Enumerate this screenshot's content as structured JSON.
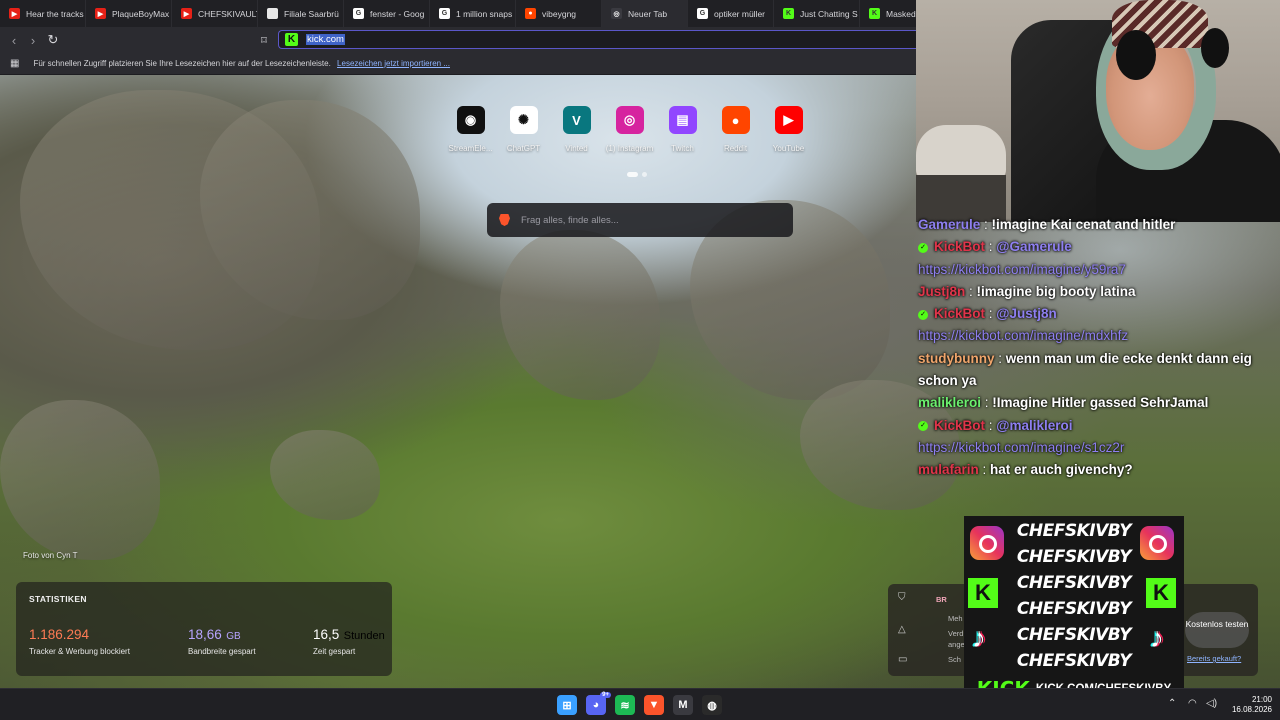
{
  "tabs": [
    {
      "label": "Hear the tracks",
      "fav_color": "#e62117",
      "fav_glyph": "▶"
    },
    {
      "label": "PlaqueBoyMax",
      "fav_color": "#e62117",
      "fav_glyph": "▶"
    },
    {
      "label": "CHEFSKIVAULT",
      "fav_color": "#e62117",
      "fav_glyph": "▶"
    },
    {
      "label": "Filiale Saarbrü",
      "fav_color": "#e8e8e8",
      "fav_glyph": ""
    },
    {
      "label": "fenster - Goog",
      "fav_color": "#ffffff",
      "fav_glyph": "G"
    },
    {
      "label": "1 million snaps",
      "fav_color": "#ffffff",
      "fav_glyph": "G"
    },
    {
      "label": "vibeygng",
      "fav_color": "#ff4500",
      "fav_glyph": "●"
    },
    {
      "label": "Neuer Tab",
      "fav_color": "#3a3a40",
      "fav_glyph": "◎"
    },
    {
      "label": "optiker müller",
      "fav_color": "#ffffff",
      "fav_glyph": "G"
    },
    {
      "label": "Just Chatting S",
      "fav_color": "#53fc18",
      "fav_glyph": "K"
    },
    {
      "label": "Masked",
      "fav_color": "#53fc18",
      "fav_glyph": "K"
    }
  ],
  "address": {
    "url": "kick.com"
  },
  "bookmarks": {
    "hint": "Für schnellen Zugriff platzieren Sie Ihre Lesezeichen hier auf der Lesezeichenleiste.",
    "import_link": "Lesezeichen jetzt importieren ..."
  },
  "shortcuts": [
    {
      "label": "StreamEle...",
      "icon": "streamelements-icon",
      "color": "#101010",
      "glyph": "◉"
    },
    {
      "label": "ChatGPT",
      "icon": "chatgpt-icon",
      "color": "#ffffff",
      "glyph": "✺"
    },
    {
      "label": "Vinted",
      "icon": "vinted-icon",
      "color": "#09777f",
      "glyph": "V"
    },
    {
      "label": "(1) Instagram",
      "icon": "instagram-icon",
      "color": "#d6249f",
      "glyph": "◎"
    },
    {
      "label": "Twitch",
      "icon": "twitch-icon",
      "color": "#9146ff",
      "glyph": "▤"
    },
    {
      "label": "Reddit",
      "icon": "reddit-icon",
      "color": "#ff4500",
      "glyph": "●"
    },
    {
      "label": "YouTube",
      "icon": "youtube-icon",
      "color": "#ff0000",
      "glyph": "▶"
    }
  ],
  "search": {
    "placeholder": "Frag alles, finde alles..."
  },
  "photo_credit": "Foto von Cyn T",
  "stats": {
    "title": "STATISTIKEN",
    "items": [
      {
        "value": "1.186.294",
        "unit": "",
        "label": "Tracker & Werbung blockiert",
        "color": "#ff7b54"
      },
      {
        "value": "18,66",
        "unit": "GB",
        "label": "Bandbreite gespart",
        "color": "#b7a4ff"
      },
      {
        "value": "16,5",
        "unit": "Stunden",
        "label": "Zeit gespart",
        "color": "#ffffff"
      }
    ]
  },
  "chat": [
    {
      "badge": false,
      "user": "Gamerule",
      "user_color": "#8e7ff0",
      "text": "!imagine Kai cenat and hitler",
      "link": ""
    },
    {
      "badge": true,
      "user": "KickBot",
      "user_color": "#e0344a",
      "text": "@Gamerule",
      "link": "https://kickbot.com/imagine/y59ra7"
    },
    {
      "badge": false,
      "user": "Justj8n",
      "user_color": "#e0344a",
      "text": "!imagine big booty latina",
      "link": ""
    },
    {
      "badge": true,
      "user": "KickBot",
      "user_color": "#e0344a",
      "text": "@Justj8n",
      "link": "https://kickbot.com/imagine/mdxhfz"
    },
    {
      "badge": false,
      "user": "studybunny",
      "user_color": "#f0a56b",
      "text": "wenn man um die ecke denkt dann eig schon ya",
      "link": ""
    },
    {
      "badge": false,
      "user": "malikleroi",
      "user_color": "#6bf06e",
      "text": "!Imagine Hitler gassed SehrJamal",
      "link": ""
    },
    {
      "badge": true,
      "user": "KickBot",
      "user_color": "#e0344a",
      "text": "@malikleroi",
      "link": "https://kickbot.com/imagine/s1cz2r"
    },
    {
      "badge": false,
      "user": "mulafarin",
      "user_color": "#e0344a",
      "text": "hat er auch givenchy?",
      "link": ""
    }
  ],
  "banner": {
    "rows": [
      "CHEFSKIVBY",
      "CHEFSKIVBY",
      "CHEFSKIVBY",
      "CHEFSKIVBY",
      "CHEFSKIVBY",
      "CHEFSKIVBY"
    ],
    "kick_logo": "KICK",
    "kick_url": "KICK.COM/CHEFSKIVBY"
  },
  "rewards": {
    "title": "BR",
    "line1": "Meh",
    "line2": "Verd",
    "line3": "ange",
    "line4": "Sch",
    "cta": "Kostenlos testen",
    "link": "Bereits gekauft?"
  },
  "taskbar": {
    "apps": [
      {
        "name": "windows-start-icon",
        "color": "#3aa0ff",
        "glyph": "⊞"
      },
      {
        "name": "discord-icon",
        "color": "#5865f2",
        "glyph": "◕",
        "badge": "9+"
      },
      {
        "name": "spotify-icon",
        "color": "#1db954",
        "glyph": "≋"
      },
      {
        "name": "brave-icon",
        "color": "#fb542b",
        "glyph": "▼"
      },
      {
        "name": "gmail-icon",
        "color": "#3a3a40",
        "glyph": "M"
      },
      {
        "name": "obs-icon",
        "color": "#2a2a2a",
        "glyph": "◍"
      }
    ],
    "time": "21:00",
    "date": "16.08.2026"
  }
}
